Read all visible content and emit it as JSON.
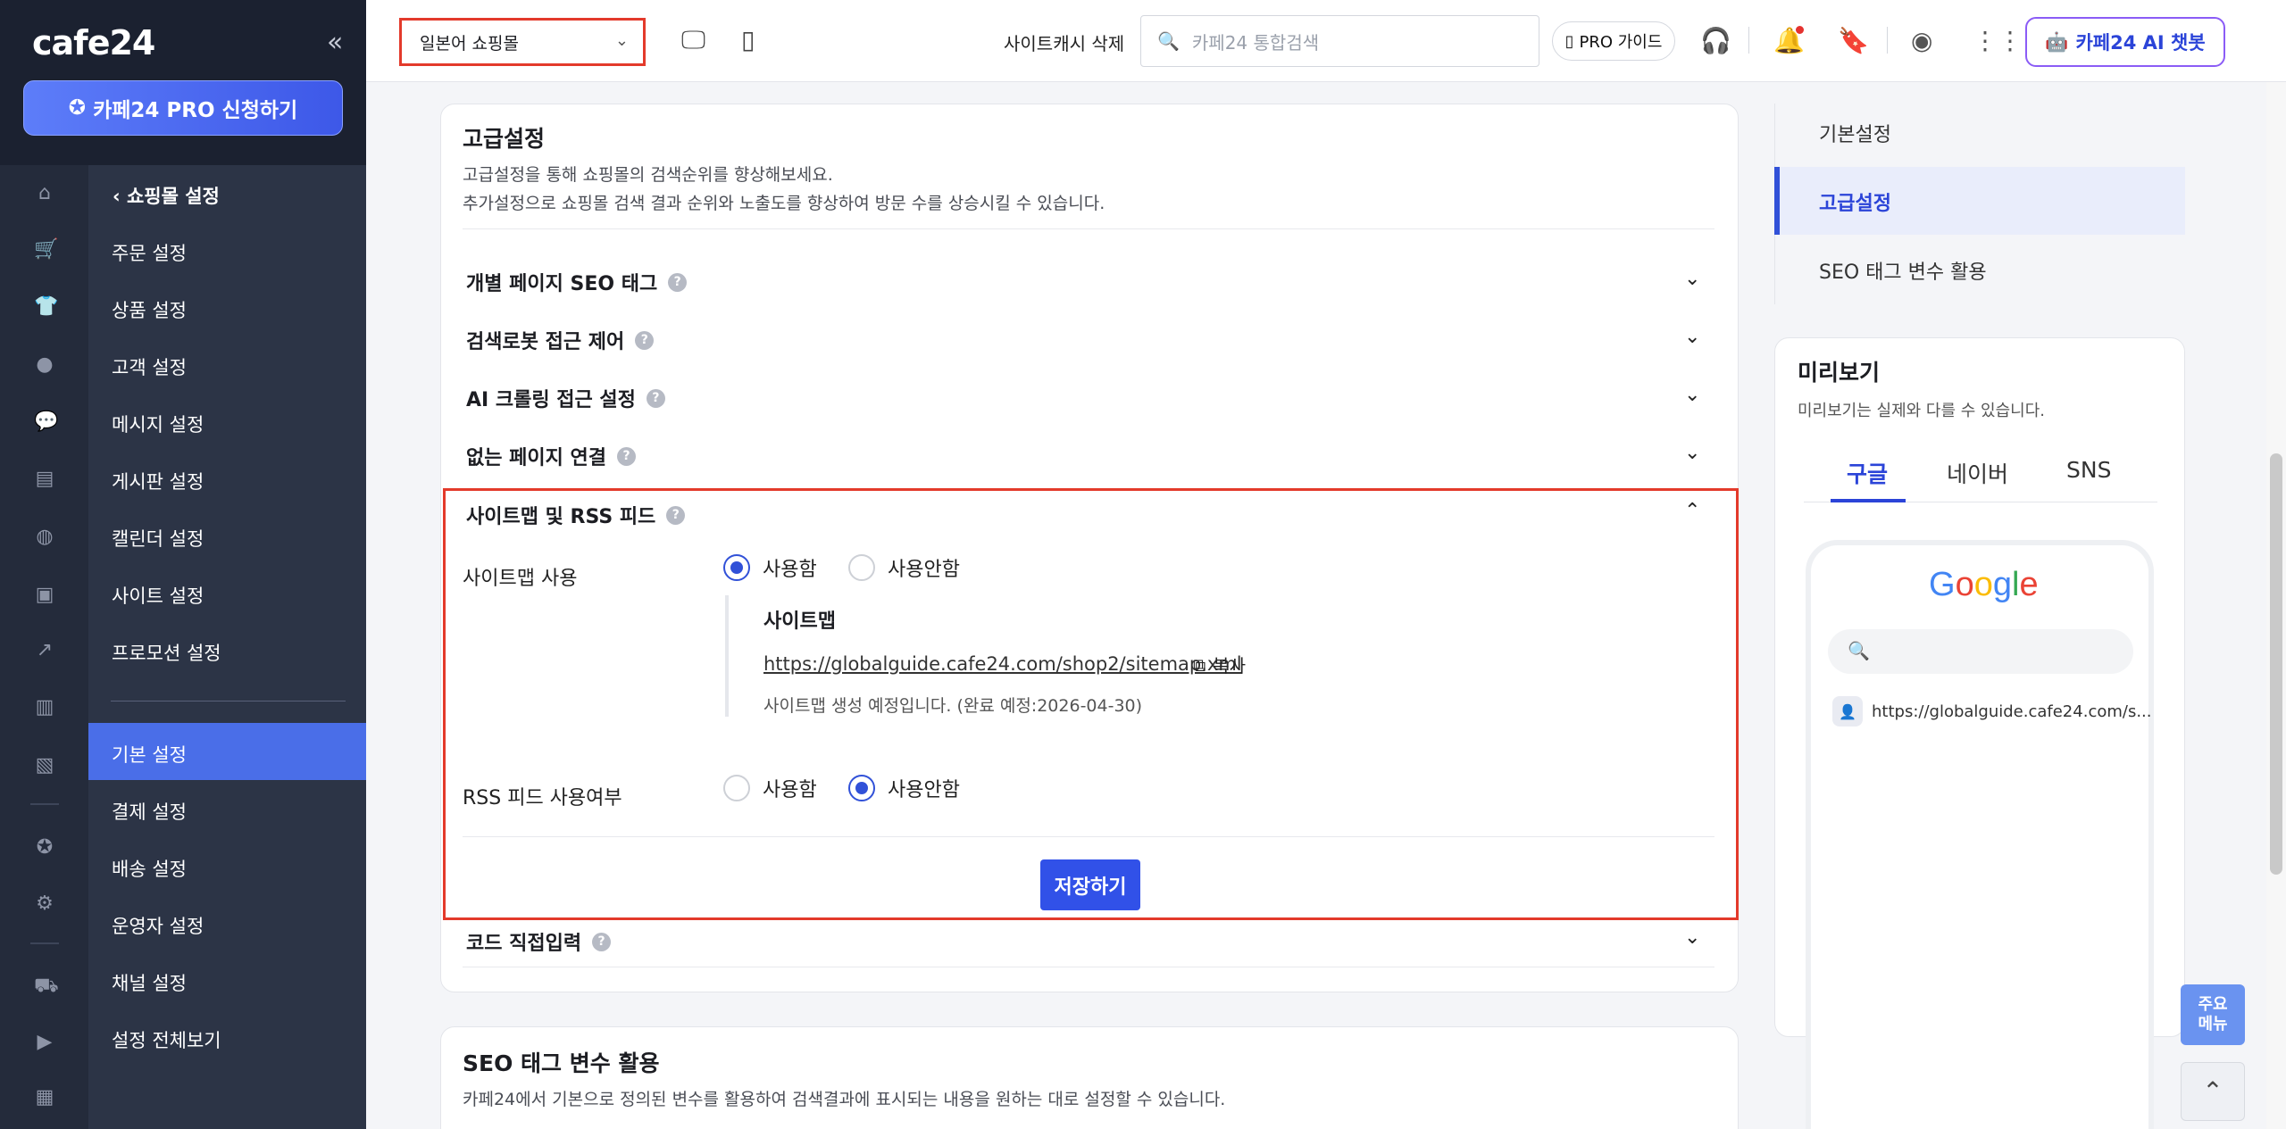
{
  "app": {
    "logo": "cafe24",
    "collapse_icon": "«"
  },
  "sidebar": {
    "pro_button": "카페24 PRO 신청하기",
    "section_header": "쇼핑몰 설정",
    "items": [
      "주문 설정",
      "상품 설정",
      "고객 설정",
      "메시지 설정",
      "게시판 설정",
      "캘린더 설정",
      "사이트 설정",
      "프로모션 설정",
      "기본 설정",
      "결제 설정",
      "배송 설정",
      "운영자 설정",
      "채널 설정",
      "설정 전체보기"
    ],
    "active_item": "기본 설정",
    "icons": [
      "home-icon",
      "cart-icon",
      "shirt-icon",
      "user-icon",
      "chat-icon",
      "board-icon",
      "palette-icon",
      "coupon-icon",
      "analytics-icon",
      "chart-icon",
      "excel-icon",
      "badge-icon",
      "settings-icon",
      "truck-icon",
      "youtube-icon",
      "briefcase-icon"
    ]
  },
  "topbar": {
    "shop_select": "일본어 쇼핑몰",
    "cache_delete": "사이트캐시 삭제",
    "search_placeholder": "카페24 통합검색",
    "pro_guide": "PRO 가이드",
    "ai_chatbot": "카페24 AI 챗봇"
  },
  "main": {
    "title": "고급설정",
    "desc1": "고급설정을 통해 쇼핑몰의 검색순위를 향상해보세요.",
    "desc2": "추가설정으로 쇼핑몰 검색 결과 순위와 노출도를 향상하여 방문 수를 상승시킬 수 있습니다.",
    "rows": [
      "개별 페이지 SEO 태그",
      "검색로봇 접근 제어",
      "AI 크롤링 접근 설정",
      "없는 페이지 연결"
    ],
    "expanded_title": "사이트맵 및 RSS 피드",
    "sitemap_label": "사이트맵 사용",
    "use": "사용함",
    "not_use": "사용안함",
    "sitemap_title": "사이트맵",
    "sitemap_url": "https://globalguide.cafe24.com/shop2/sitemap.xml",
    "copy": "복사",
    "sitemap_note": "사이트맵 생성 예정입니다. (완료 예정:2026-04-30)",
    "rss_label": "RSS 피드 사용여부",
    "sitemap_selected": "사용함",
    "rss_selected": "사용안함",
    "save": "저장하기",
    "code_row": "코드 직접입력"
  },
  "seo_card": {
    "title": "SEO 태그 변수 활용",
    "desc": "카페24에서 기본으로 정의된 변수를 활용하여 검색결과에 표시되는 내용을 원하는 대로 설정할 수 있습니다."
  },
  "right_nav": {
    "items": [
      "기본설정",
      "고급설정",
      "SEO 태그 변수 활용"
    ],
    "active": "고급설정"
  },
  "preview": {
    "title": "미리보기",
    "desc": "미리보기는 실제와 다를 수 있습니다.",
    "tabs": [
      "구글",
      "네이버",
      "SNS"
    ],
    "active_tab": "구글",
    "google_logo": "Google",
    "result_url": "https://globalguide.cafe24.com/s..."
  },
  "fab": {
    "menu": "주요\n메뉴",
    "top": "^"
  },
  "colors": {
    "accent": "#3151d8",
    "highlight": "#e33a2b",
    "sidebar_bg": "#1b2130",
    "active_nav": "#4a6ee8"
  }
}
